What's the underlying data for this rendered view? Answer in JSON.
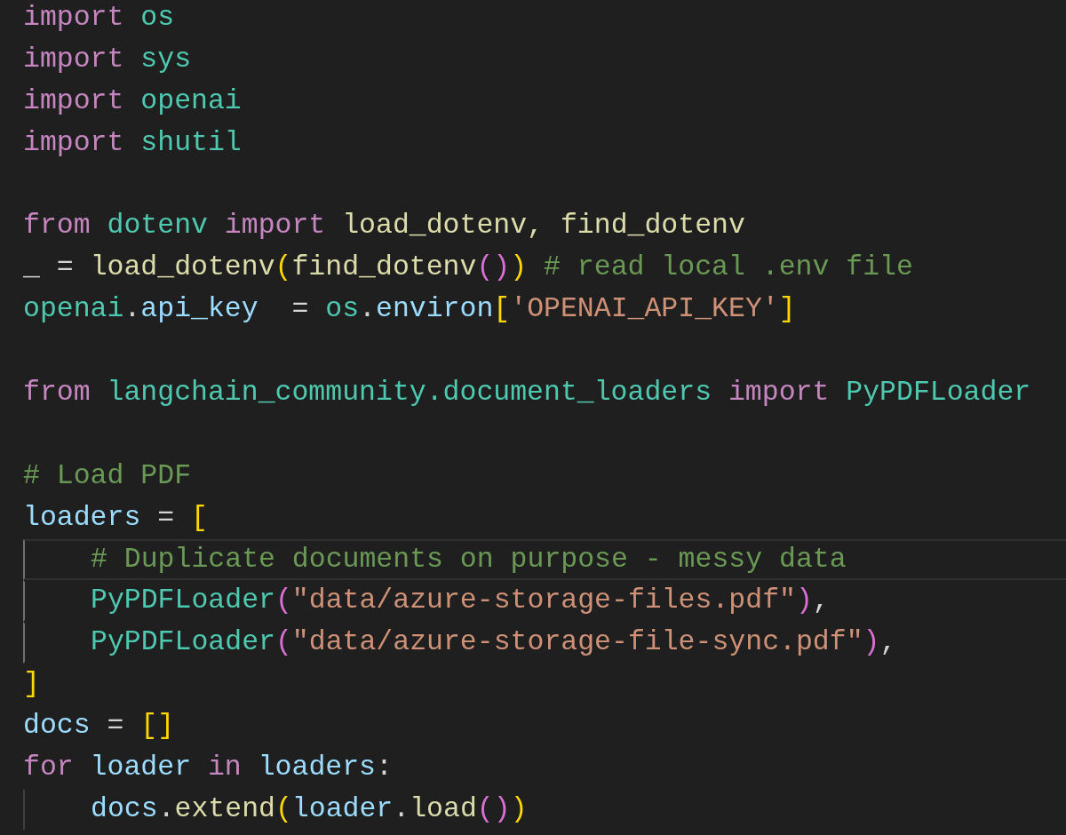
{
  "editor": {
    "blocks": [
      {
        "lines": [
          {
            "current": false,
            "indented": false,
            "tokens": [
              {
                "text": "import",
                "kind": "keyword"
              },
              {
                "text": " os",
                "kind": "module"
              }
            ]
          },
          {
            "current": false,
            "indented": false,
            "tokens": [
              {
                "text": "import",
                "kind": "keyword"
              },
              {
                "text": " sys",
                "kind": "module"
              }
            ]
          },
          {
            "current": false,
            "indented": false,
            "tokens": [
              {
                "text": "import",
                "kind": "keyword"
              },
              {
                "text": " openai",
                "kind": "module"
              }
            ]
          },
          {
            "current": false,
            "indented": false,
            "tokens": [
              {
                "text": "import",
                "kind": "keyword"
              },
              {
                "text": " shutil",
                "kind": "module"
              }
            ]
          }
        ]
      },
      {
        "lines": [
          {
            "current": false,
            "indented": false,
            "tokens": [
              {
                "text": "from",
                "kind": "keyword"
              },
              {
                "text": " dotenv",
                "kind": "module"
              },
              {
                "text": " import",
                "kind": "keyword"
              },
              {
                "text": " load_dotenv, find_dotenv",
                "kind": "function"
              }
            ]
          },
          {
            "current": false,
            "indented": false,
            "tokens": [
              {
                "text": "_ = ",
                "kind": "plain"
              },
              {
                "text": "load_dotenv",
                "kind": "function"
              },
              {
                "text": "(",
                "kind": "bracket1"
              },
              {
                "text": "find_dotenv",
                "kind": "function"
              },
              {
                "text": "()",
                "kind": "bracket2"
              },
              {
                "text": ")",
                "kind": "bracket1"
              },
              {
                "text": " # read local .env file",
                "kind": "comment"
              }
            ]
          },
          {
            "current": false,
            "indented": false,
            "tokens": [
              {
                "text": "openai",
                "kind": "module"
              },
              {
                "text": ".",
                "kind": "plain"
              },
              {
                "text": "api_key",
                "kind": "variable"
              },
              {
                "text": "  = ",
                "kind": "plain"
              },
              {
                "text": "os",
                "kind": "module"
              },
              {
                "text": ".",
                "kind": "plain"
              },
              {
                "text": "environ",
                "kind": "variable"
              },
              {
                "text": "[",
                "kind": "bracket1"
              },
              {
                "text": "'OPENAI_API_KEY'",
                "kind": "string"
              },
              {
                "text": "]",
                "kind": "bracket1"
              }
            ]
          }
        ]
      },
      {
        "lines": [
          {
            "current": false,
            "indented": false,
            "tokens": [
              {
                "text": "from",
                "kind": "keyword"
              },
              {
                "text": " langchain_community.document_loaders",
                "kind": "module"
              },
              {
                "text": " import",
                "kind": "keyword"
              },
              {
                "text": " PyPDFLoader",
                "kind": "module"
              }
            ]
          }
        ]
      },
      {
        "lines": [
          {
            "current": false,
            "indented": false,
            "tokens": [
              {
                "text": "# Load PDF",
                "kind": "comment"
              }
            ]
          },
          {
            "current": false,
            "indented": false,
            "tokens": [
              {
                "text": "loaders",
                "kind": "variable"
              },
              {
                "text": " = ",
                "kind": "plain"
              },
              {
                "text": "[",
                "kind": "bracket1"
              }
            ]
          },
          {
            "current": true,
            "indented": true,
            "guide_active": true,
            "tokens": [
              {
                "text": "# Duplicate documents on purpose - messy data",
                "kind": "comment"
              }
            ]
          },
          {
            "current": false,
            "indented": true,
            "guide_active": true,
            "tokens": [
              {
                "text": "PyPDFLoader",
                "kind": "module"
              },
              {
                "text": "(",
                "kind": "bracket2"
              },
              {
                "text": "\"data/azure-storage-files.pdf\"",
                "kind": "string"
              },
              {
                "text": ")",
                "kind": "bracket2"
              },
              {
                "text": ",",
                "kind": "plain"
              }
            ]
          },
          {
            "current": false,
            "indented": true,
            "guide_active": true,
            "tokens": [
              {
                "text": "PyPDFLoader",
                "kind": "module"
              },
              {
                "text": "(",
                "kind": "bracket2"
              },
              {
                "text": "\"data/azure-storage-file-sync.pdf\"",
                "kind": "string"
              },
              {
                "text": ")",
                "kind": "bracket2"
              },
              {
                "text": ",",
                "kind": "plain"
              }
            ]
          },
          {
            "current": false,
            "indented": false,
            "tokens": [
              {
                "text": "]",
                "kind": "bracket1"
              }
            ]
          },
          {
            "current": false,
            "indented": false,
            "tokens": [
              {
                "text": "docs",
                "kind": "variable"
              },
              {
                "text": " = ",
                "kind": "plain"
              },
              {
                "text": "[]",
                "kind": "bracket1"
              }
            ]
          },
          {
            "current": false,
            "indented": false,
            "tokens": [
              {
                "text": "for",
                "kind": "keyword"
              },
              {
                "text": " loader",
                "kind": "variable"
              },
              {
                "text": " in",
                "kind": "keyword"
              },
              {
                "text": " loaders",
                "kind": "variable"
              },
              {
                "text": ":",
                "kind": "plain"
              }
            ]
          },
          {
            "current": false,
            "indented": true,
            "guide_active": false,
            "tokens": [
              {
                "text": "docs",
                "kind": "variable"
              },
              {
                "text": ".",
                "kind": "plain"
              },
              {
                "text": "extend",
                "kind": "function"
              },
              {
                "text": "(",
                "kind": "bracket1"
              },
              {
                "text": "loader",
                "kind": "variable"
              },
              {
                "text": ".",
                "kind": "plain"
              },
              {
                "text": "load",
                "kind": "function"
              },
              {
                "text": "()",
                "kind": "bracket2"
              },
              {
                "text": ")",
                "kind": "bracket1"
              }
            ]
          }
        ]
      }
    ]
  }
}
